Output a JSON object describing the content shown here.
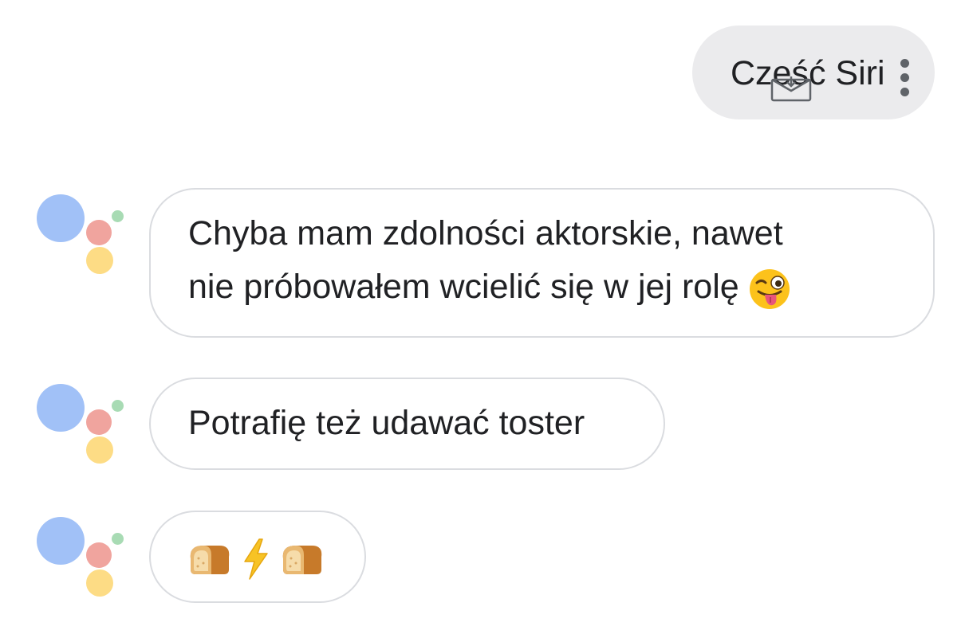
{
  "user_message": {
    "text": "Cześć Siri"
  },
  "assistant_messages": [
    {
      "lines": [
        "Chyba mam zdolności aktorskie, nawet",
        "nie próbowałem wcielić się w jej rolę"
      ],
      "emoji": "winking-face-with-tongue"
    },
    {
      "lines": [
        "Potrafię też udawać toster"
      ]
    },
    {
      "emoji_sequence": [
        "bread",
        "high-voltage",
        "bread"
      ]
    }
  ],
  "colors": {
    "user_bubble": "#ebebed",
    "bubble_border": "#dadce0",
    "text": "#202124",
    "logo_blue": "#a1c1f7",
    "logo_red": "#f0a49e",
    "logo_green": "#a8dbb4",
    "logo_yellow": "#fddc85"
  }
}
